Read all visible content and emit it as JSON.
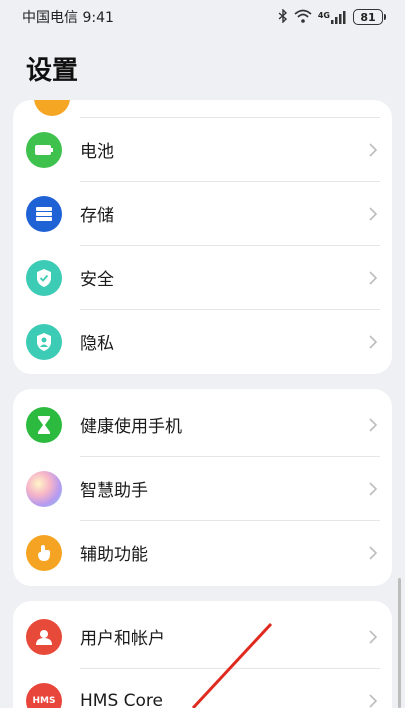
{
  "status_bar": {
    "carrier_time": "中国电信 9:41",
    "icons": [
      "bluetooth-icon",
      "wifi-icon",
      "4g-signal-icon"
    ],
    "network": "4G",
    "battery": "81"
  },
  "title": "设置",
  "groups": [
    {
      "items": [
        {
          "label": "电池",
          "icon": "battery-icon",
          "color": "#3fc24d"
        },
        {
          "label": "存储",
          "icon": "storage-icon",
          "color": "#1f62d6"
        },
        {
          "label": "安全",
          "icon": "shield-icon",
          "color": "#3ccbb5"
        },
        {
          "label": "隐私",
          "icon": "privacy-icon",
          "color": "#3ccbb5"
        }
      ]
    },
    {
      "items": [
        {
          "label": "健康使用手机",
          "icon": "hourglass-icon",
          "color": "#2dbb3f"
        },
        {
          "label": "智慧助手",
          "icon": "assistant-icon",
          "color": "#c9a4e8"
        },
        {
          "label": "辅助功能",
          "icon": "hand-icon",
          "color": "#f5a323"
        }
      ]
    },
    {
      "items": [
        {
          "label": "用户和帐户",
          "icon": "user-icon",
          "color": "#e84a3a"
        },
        {
          "label": "HMS Core",
          "icon": "hms-icon",
          "color": "#e8463a",
          "badge": "HMS"
        }
      ]
    }
  ]
}
